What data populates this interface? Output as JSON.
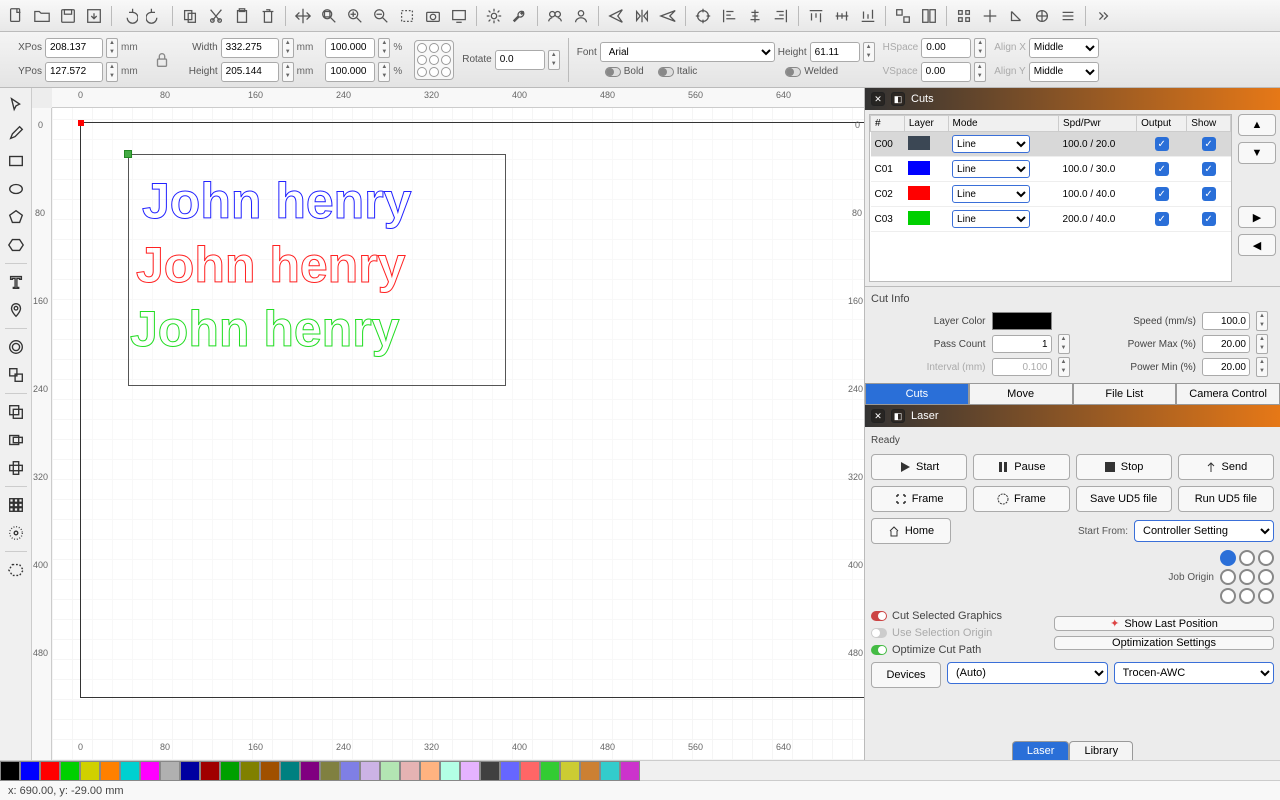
{
  "toolbar": {
    "icons": [
      "new",
      "open",
      "save",
      "import",
      "undo",
      "redo",
      "copy",
      "cut",
      "paste",
      "delete",
      "move",
      "zoom-fit",
      "zoom-in",
      "zoom-out",
      "marquee",
      "screenshot",
      "preview",
      "gear",
      "wrench",
      "group-add",
      "user",
      "send1",
      "mirror-h",
      "send2",
      "target",
      "align1",
      "align2",
      "align3",
      "dist1",
      "dist2",
      "dist3",
      "arr1",
      "arr2",
      "arr3",
      "arr4",
      "arr5",
      "arr6",
      "more"
    ]
  },
  "props": {
    "xpos_lbl": "XPos",
    "xpos": "208.137",
    "ypos_lbl": "YPos",
    "ypos": "127.572",
    "width_lbl": "Width",
    "width": "332.275",
    "height_lbl": "Height",
    "height": "205.144",
    "pctw": "100.000",
    "pcth": "100.000",
    "mm": "mm",
    "pct": "%",
    "rotate_lbl": "Rotate",
    "rotate": "0.0",
    "font_lbl": "Font",
    "font": "Arial",
    "th_lbl": "Height",
    "th": "61.11",
    "bold": "Bold",
    "italic": "Italic",
    "welded": "Welded",
    "hspace_lbl": "HSpace",
    "hspace": "0.00",
    "vspace_lbl": "VSpace",
    "vspace": "0.00",
    "alignx_lbl": "Align X",
    "alignx": "Middle",
    "aligny_lbl": "Align Y",
    "aligny": "Middle"
  },
  "leftTools": [
    "select",
    "pen",
    "rect",
    "circle",
    "poly5",
    "poly6",
    "",
    "text",
    "marker",
    "",
    "ring",
    "group",
    "",
    "bool1",
    "bool2",
    "bool3",
    "",
    "grid",
    "radial",
    "",
    "outline"
  ],
  "rulerH": [
    "0",
    "80",
    "160",
    "240",
    "320",
    "400",
    "480",
    "560",
    "640",
    "0",
    "80",
    "160",
    "240",
    "320",
    "400",
    "480",
    "560",
    "640"
  ],
  "rulerV": [
    "0",
    "80",
    "160",
    "240",
    "320",
    "400",
    "480"
  ],
  "canvasText": "John henry",
  "cuts": {
    "title": "Cuts",
    "headers": {
      "num": "#",
      "layer": "Layer",
      "mode": "Mode",
      "sp": "Spd/Pwr",
      "out": "Output",
      "show": "Show"
    },
    "rows": [
      {
        "id": "C00",
        "color": "#3b4754",
        "mode": "Line",
        "sp": "100.0 / 20.0",
        "sel": true
      },
      {
        "id": "C01",
        "color": "#0000ff",
        "mode": "Line",
        "sp": "100.0 / 30.0"
      },
      {
        "id": "C02",
        "color": "#ff0000",
        "mode": "Line",
        "sp": "100.0 / 40.0"
      },
      {
        "id": "C03",
        "color": "#00d000",
        "mode": "Line",
        "sp": "200.0 / 40.0"
      }
    ],
    "info": {
      "title": "Cut Info",
      "layer_color_lbl": "Layer Color",
      "speed_lbl": "Speed (mm/s)",
      "speed": "100.0",
      "pass_lbl": "Pass Count",
      "pass": "1",
      "pmax_lbl": "Power Max (%)",
      "pmax": "20.00",
      "interval_lbl": "Interval (mm)",
      "interval": "0.100",
      "pmin_lbl": "Power Min (%)",
      "pmin": "20.00"
    },
    "tabs": [
      "Cuts",
      "Move",
      "File List",
      "Camera Control"
    ]
  },
  "laser": {
    "title": "Laser",
    "status": "Ready",
    "start": "Start",
    "pause": "Pause",
    "stop": "Stop",
    "send": "Send",
    "frame": "Frame",
    "saveud5": "Save UD5 file",
    "runud5": "Run UD5 file",
    "home": "Home",
    "startfrom_lbl": "Start From:",
    "startfrom": "Controller Setting",
    "joborigin_lbl": "Job Origin",
    "cutsel": "Cut Selected Graphics",
    "useorigin": "Use Selection Origin",
    "optimize": "Optimize Cut Path",
    "showlast": "Show Last Position",
    "optset": "Optimization Settings",
    "devices": "Devices",
    "auto": "(Auto)",
    "controller": "Trocen-AWC",
    "bottabs": [
      "Laser",
      "Library"
    ]
  },
  "palette": [
    "#000000",
    "#0000ff",
    "#ff0000",
    "#00d000",
    "#d0d000",
    "#ff8000",
    "#00d0d0",
    "#ff00ff",
    "#b0b0b0",
    "#0000a0",
    "#a00000",
    "#00a000",
    "#808000",
    "#a05000",
    "#008080",
    "#800080",
    "#808040",
    "#7f7fe5",
    "#ccb3e5",
    "#b3e5b3",
    "#e5b3b3",
    "#ffb380",
    "#b3ffe5",
    "#e5b3ff",
    "#404040",
    "#6666ff",
    "#ff6666",
    "#33cc33",
    "#cccc33",
    "#cc8033",
    "#33cccc",
    "#cc33cc"
  ],
  "status": "x: 690.00, y: -29.00 mm"
}
